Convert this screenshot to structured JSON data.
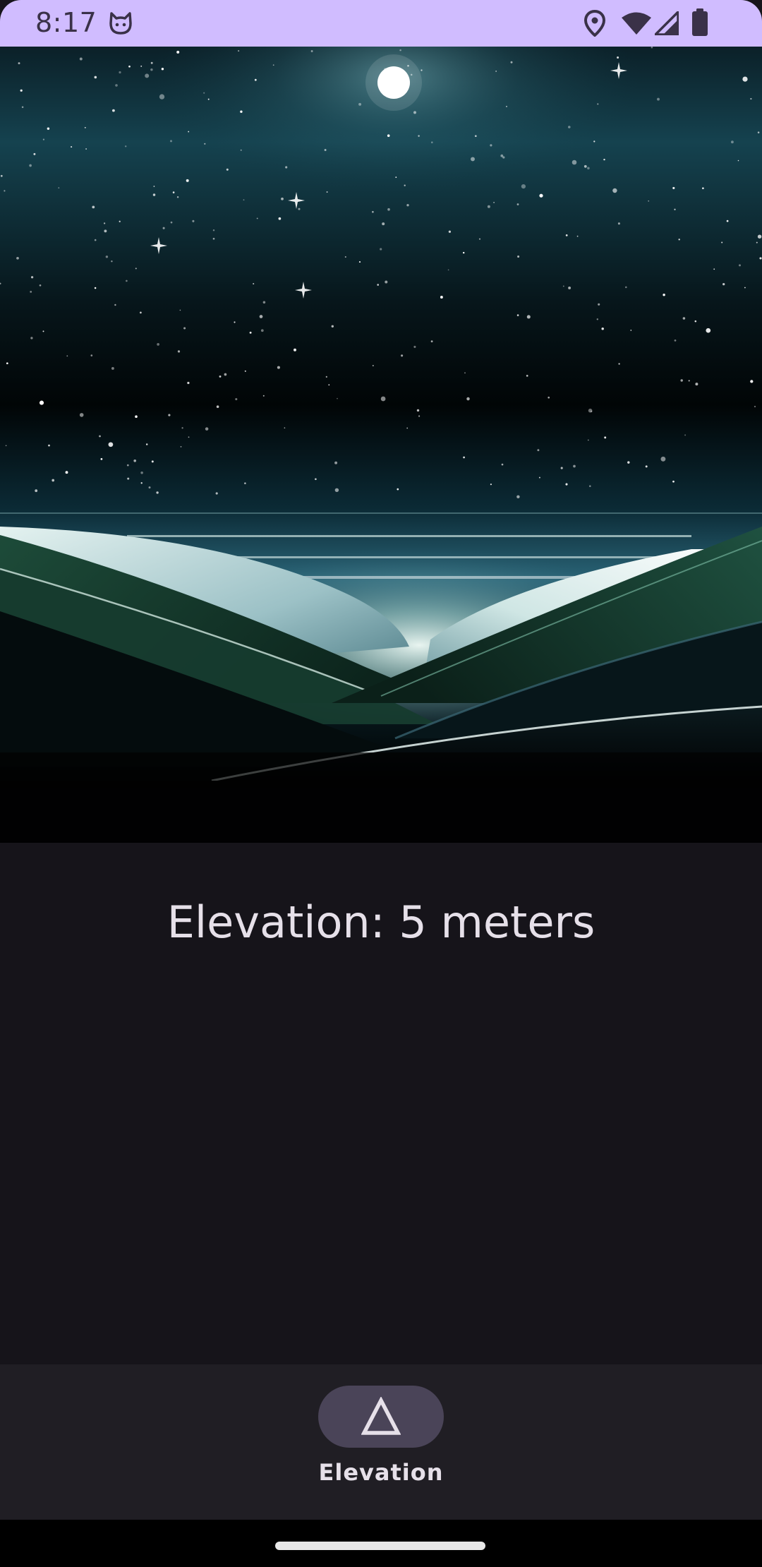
{
  "status_bar": {
    "time": "8:17",
    "icons": [
      "cat-face-icon",
      "location-pin-icon",
      "wifi-icon",
      "signal-icon",
      "battery-icon"
    ],
    "background": "#d0bcff"
  },
  "hero_image": {
    "description_icon": "night-landscape-image"
  },
  "main": {
    "elevation_text": "Elevation: 5 meters"
  },
  "bottom_nav": {
    "items": [
      {
        "label": "Elevation",
        "icon": "triangle-icon",
        "selected": true
      }
    ],
    "indicator_color": "#4a4458",
    "background": "#201e24"
  },
  "colors": {
    "surface": "#16141a",
    "on_surface": "#e6e0e9",
    "status_bar": "#d0bcff"
  }
}
